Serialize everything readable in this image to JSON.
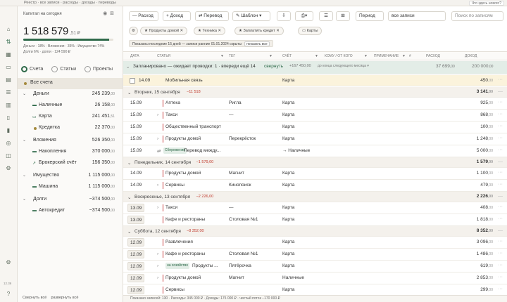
{
  "topbar": {
    "menu": "Реестр · все записи · расходы · доходы · переводы",
    "alert": "Что здесь нового?"
  },
  "sidebar": {
    "title": "Капитал на сегодня",
    "balance": "1 518 579",
    "balance_cur": ",51 ₽",
    "progress": 0.95,
    "stats": [
      "Деньги · 18% · Вложения · 35% · Имущество 74%",
      "Долги 6% · долги · 124 590 ₽"
    ],
    "tabs": [
      "Счета",
      "Статьи",
      "Проекты"
    ],
    "all_label": "Все счета",
    "groups": [
      {
        "name": "Деньги",
        "amount": "245 239",
        "items": [
          {
            "name": "Наличные",
            "amount": "26 158"
          },
          {
            "name": "Карта",
            "amount": "241 451"
          },
          {
            "name": "Кредитка",
            "amount": "22 370"
          }
        ]
      },
      {
        "name": "Вложения",
        "amount": "526 350",
        "items": [
          {
            "name": "Накопления",
            "amount": "370 000"
          },
          {
            "name": "Брокерский счёт",
            "amount": "156 350"
          }
        ]
      },
      {
        "name": "Имущество",
        "amount": "1 115 000",
        "items": [
          {
            "name": "Машина",
            "amount": "1 115 000"
          }
        ]
      },
      {
        "name": "Долги",
        "amount": "−374 500",
        "items": [
          {
            "name": "Автокредит",
            "amount": "−374 500"
          }
        ]
      }
    ],
    "footer_left": "Свернуть всё",
    "footer_right": "развернуть всё",
    "version": "12.36"
  },
  "toolbar": {
    "expense": "— Расход",
    "income": "+ Доход",
    "transfer": "⇄ Перевод",
    "template": "✎ Шаблон ▾",
    "period": "Период",
    "kind": "все записи",
    "search": "Поиск по записям"
  },
  "chips": [
    "Продукты домой",
    "Техника",
    "Заплатить кредит",
    "Карты"
  ],
  "filter_note": "Показаны последние 15 дней — записи ранние 01.01.2024 скрыты",
  "filter_reset": "показать все",
  "columns": [
    "Дата",
    "Статья",
    "Тег",
    "Счёт",
    "Кому / от кого",
    "Примечание",
    "#",
    "Расход",
    "Доход"
  ],
  "rows": [
    {
      "kind": "planned",
      "text": "Запланировано — ожидает проводки: 1 · впереди ещё 14",
      "link": "свернуть",
      "sub": "+167 450,00",
      "note": "до конца следующего месяца ▾",
      "exp": "37 699",
      "inc": "200 000"
    },
    {
      "kind": "mobile",
      "date": "14.09",
      "cat": "Мобильная связь",
      "acc": "Карта",
      "exp": "450"
    },
    {
      "kind": "day",
      "label": "Вторник, 15 сентября",
      "neg": "−11 518",
      "total": "3 141"
    },
    {
      "kind": "tx",
      "date": "15.09",
      "cat": "Аптека",
      "tag": "Ригла",
      "acc": "Карта",
      "exp": "925"
    },
    {
      "kind": "tx",
      "date": "15.09",
      "caret": true,
      "cat": "Такси",
      "tag": "—",
      "acc": "Карта",
      "exp": "868"
    },
    {
      "kind": "tx",
      "date": "15.09",
      "cat": "Общественный транспорт",
      "tag": "",
      "acc": "Карта",
      "exp": "100"
    },
    {
      "kind": "tx",
      "date": "15.09",
      "caret": true,
      "cat": "Продукты домой",
      "tag": "Перекрёсток",
      "acc": "Карта",
      "exp": "1 248"
    },
    {
      "kind": "transfer",
      "date": "15.09",
      "chip": "Сбережения",
      "cat": "Перевод между...",
      "acc": "→ Наличные",
      "exp": "5 000"
    },
    {
      "kind": "day",
      "label": "Понедельник, 14 сентября",
      "neg": "−1 579,00",
      "total": "1 579"
    },
    {
      "kind": "tx",
      "date": "14.09",
      "cat": "Продукты домой",
      "tag": "Магнит",
      "acc": "Карта",
      "exp": "1 100"
    },
    {
      "kind": "tx",
      "date": "14.09",
      "caret": true,
      "cat": "Сервисы",
      "tag": "Кинопоиск",
      "acc": "Карта",
      "exp": "479"
    },
    {
      "kind": "day",
      "label": "Воскресенье, 13 сентября",
      "neg": "−2 226,00",
      "total": "2 226"
    },
    {
      "kind": "tx",
      "date": "13.09",
      "box": true,
      "caret": true,
      "cat": "Такси",
      "tag": "—",
      "acc": "Карта",
      "exp": "408"
    },
    {
      "kind": "tx",
      "date": "13.09",
      "box": true,
      "cat": "Кафе и рестораны",
      "tag": "Столовая №1",
      "acc": "Карта",
      "exp": "1 818"
    },
    {
      "kind": "day",
      "label": "Суббота, 12 сентября",
      "neg": "−8 352,00",
      "total": "8 352"
    },
    {
      "kind": "tx",
      "date": "12.09",
      "box": true,
      "cat": "Развлечения",
      "tag": "",
      "acc": "Карта",
      "exp": "3 096"
    },
    {
      "kind": "tx",
      "date": "12.09",
      "box": true,
      "caret": true,
      "cat": "Кафе и рестораны",
      "tag": "Столовая №1",
      "acc": "Карта",
      "exp": "1 486"
    },
    {
      "kind": "transfer2",
      "date": "12.09",
      "box": true,
      "chip": "на хозяйство",
      "cat": "Продукты ...",
      "tag": "Пятёрочка",
      "acc": "Карта",
      "exp": "619"
    },
    {
      "kind": "tx",
      "date": "12.09",
      "box": true,
      "caret": true,
      "cat": "Продукты домой",
      "tag": "Магнит",
      "acc": "Наличные",
      "exp": "2 853"
    },
    {
      "kind": "tx",
      "date": "12.09",
      "box": true,
      "cat": "Сервисы",
      "tag": "",
      "acc": "Карта",
      "exp": "299"
    }
  ],
  "statusbar": "Показано записей: 130 · Расходы: 345 000 ₽ · Доходы: 175 000 ₽ · чистый поток −170 000 ₽",
  "colors": {
    "accent": "#2f6a4a",
    "negative": "#c0392b",
    "planned": "#e3ede7",
    "highlight": "#fbf3dc"
  }
}
